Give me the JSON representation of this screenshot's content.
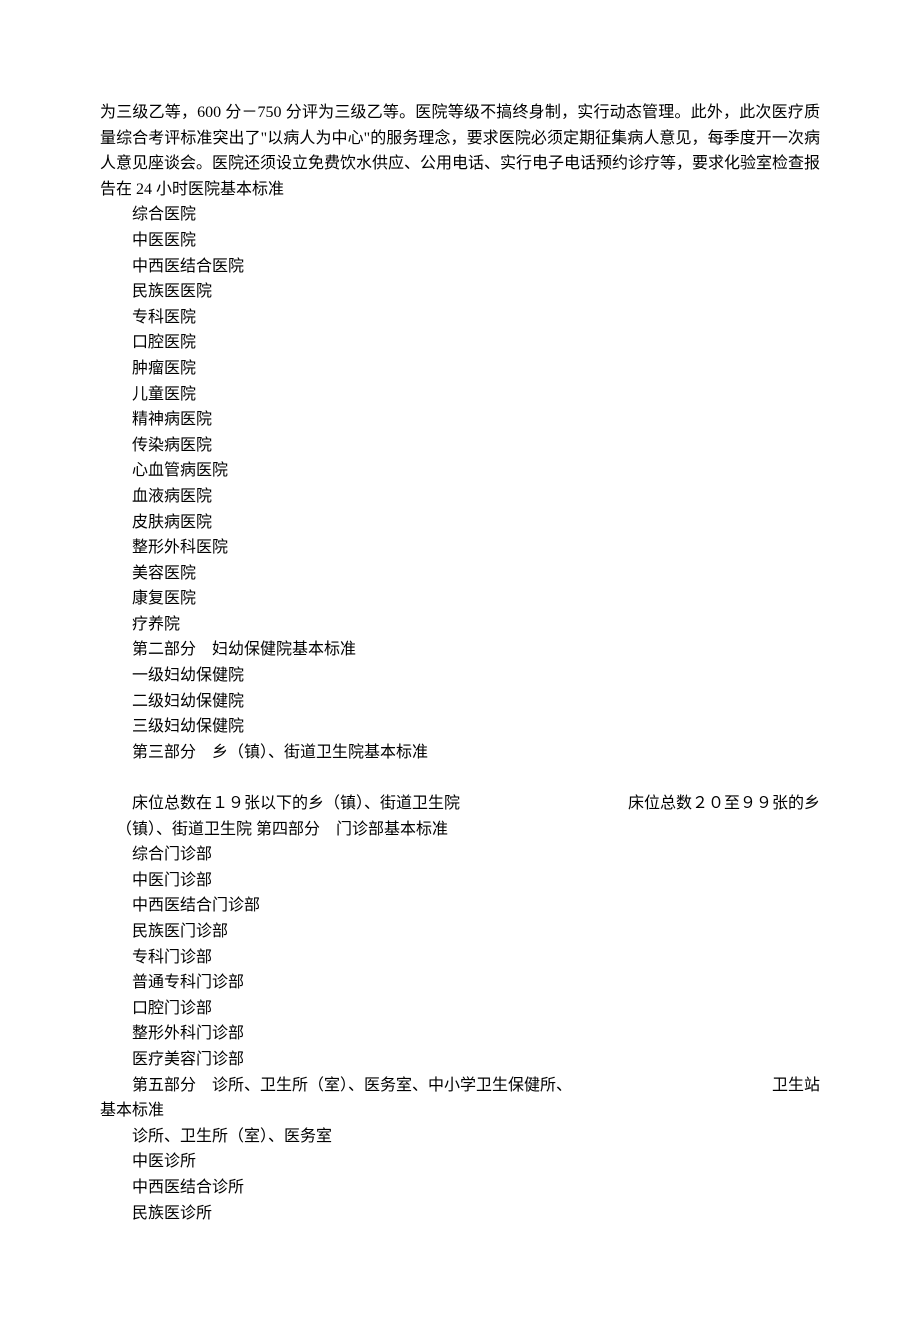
{
  "intro_para": "为三级乙等，600 分－750 分评为三级乙等。医院等级不搞终身制，实行动态管理。此外，此次医疗质量综合考评标准突出了\"以病人为中心\"的服务理念，要求医院必须定期征集病人意见，每季度开一次病人意见座谈会。医院还须设立免费饮水供应、公用电话、实行电子电话预约诊疗等，要求化验室检查报告在 24 小时医院基本标准",
  "hospital_types": [
    "综合医院",
    "中医医院",
    "中西医结合医院",
    "民族医医院",
    "专科医院",
    "口腔医院",
    "肿瘤医院",
    "儿童医院",
    "精神病医院",
    "传染病医院",
    "心血管病医院",
    "血液病医院",
    "皮肤病医院",
    "整形外科医院",
    "美容医院",
    "康复医院",
    "疗养院"
  ],
  "part2_title": "第二部分　妇幼保健院基本标准",
  "part2_items": [
    "一级妇幼保健院",
    "二级妇幼保健院",
    "三级妇幼保健院"
  ],
  "part3_title": "第三部分　乡（镇）、街道卫生院基本标准",
  "part3_item1_left": "床位总数在１９张以下的乡（镇）、街道卫生院",
  "part3_item1_right": "床位总数２０至９９张的乡",
  "part3_item2": "（镇）、街道卫生院 第四部分　门诊部基本标准",
  "part4_items": [
    "综合门诊部",
    "中医门诊部",
    "中西医结合门诊部",
    "民族医门诊部",
    "专科门诊部",
    "普通专科门诊部",
    "口腔门诊部",
    "整形外科门诊部",
    "医疗美容门诊部"
  ],
  "part5_left": "第五部分　诊所、卫生所（室）、医务室、中小学卫生保健所、",
  "part5_right": "卫生站",
  "part5_cont": "基本标准",
  "part5_items": [
    "诊所、卫生所（室）、医务室",
    "中医诊所",
    "中西医结合诊所",
    "民族医诊所"
  ]
}
